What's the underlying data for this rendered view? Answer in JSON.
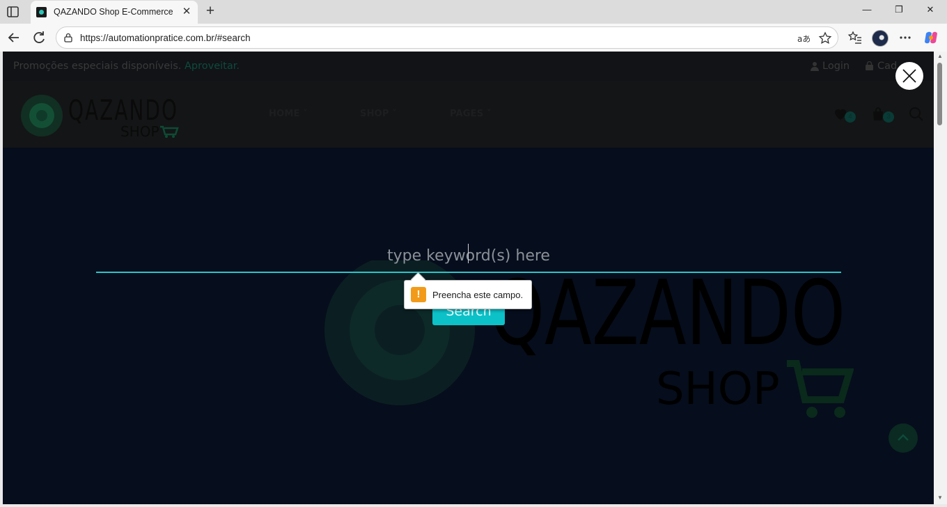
{
  "browser": {
    "tab_title": "QAZANDO Shop E-Commerce",
    "tab_close": "✕",
    "new_tab": "+",
    "url": "https://automationpratice.com.br/#search",
    "window_controls": {
      "minimize": "—",
      "restore": "❐",
      "close": "✕"
    }
  },
  "promo": {
    "text": "Promoções especiais disponíveis.",
    "link": "Aproveitar.",
    "login": "Login",
    "cadastro": "Cad"
  },
  "nav": {
    "home": "HOME",
    "shop": "SHOP",
    "pages": "PAGES"
  },
  "header": {
    "wishlist_count": "4",
    "cart_count": "3"
  },
  "logo": {
    "brand": "QAZANDO",
    "sub": "SHOP"
  },
  "search": {
    "placeholder": "type keyword(s) here",
    "button_label": "Search"
  },
  "validation": {
    "icon": "!",
    "message": "Preencha este campo."
  },
  "colors": {
    "accent": "#0cc1c8",
    "overlay": "#060d1c",
    "warning": "#f29b1b"
  }
}
